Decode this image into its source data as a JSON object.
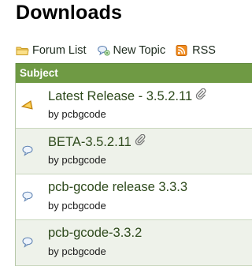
{
  "page": {
    "title": "Downloads"
  },
  "toolbar": {
    "items": [
      {
        "label": "Forum List",
        "icon": "folder-icon"
      },
      {
        "label": "New Topic",
        "icon": "new-topic-icon"
      },
      {
        "label": "RSS",
        "icon": "rss-icon"
      }
    ]
  },
  "table": {
    "header": "Subject",
    "rows": [
      {
        "title": "Latest Release - 3.5.2.11",
        "by": "by",
        "author": "pcbgcode",
        "icon": "sticky-announcement-icon",
        "attachment": true
      },
      {
        "title": "BETA-3.5.2.11",
        "by": "by",
        "author": "pcbgcode",
        "icon": "topic-bubble-icon",
        "attachment": true
      },
      {
        "title": "pcb-gcode release 3.3.3",
        "by": "by",
        "author": "pcbgcode",
        "icon": "topic-bubble-icon",
        "attachment": false
      },
      {
        "title": "pcb-gcode-3.3.2",
        "by": "by",
        "author": "pcbgcode",
        "icon": "topic-bubble-icon",
        "attachment": false
      }
    ]
  },
  "colors": {
    "header_bg": "#6f9a44",
    "link": "#2e4a1c",
    "row_alt": "#eef2ea"
  }
}
